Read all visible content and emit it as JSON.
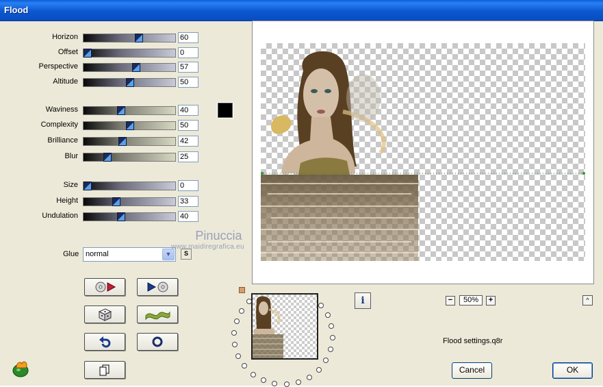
{
  "window": {
    "title": "Flood"
  },
  "sliders": [
    {
      "label": "Horizon",
      "value": "60",
      "style": "gray"
    },
    {
      "label": "Offset",
      "value": "0",
      "style": "gray"
    },
    {
      "label": "Perspective",
      "value": "57",
      "style": "gray"
    },
    {
      "label": "Altitude",
      "value": "50",
      "style": "gray"
    },
    {
      "label": "Waviness",
      "value": "40",
      "style": "olive"
    },
    {
      "label": "Complexity",
      "value": "50",
      "style": "olive"
    },
    {
      "label": "Brilliance",
      "value": "42",
      "style": "olive"
    },
    {
      "label": "Blur",
      "value": "25",
      "style": "olive"
    },
    {
      "label": "Size",
      "value": "0",
      "style": "gray"
    },
    {
      "label": "Height",
      "value": "33",
      "style": "gray"
    },
    {
      "label": "Undulation",
      "value": "40",
      "style": "gray"
    }
  ],
  "glue": {
    "label": "Glue",
    "value": "normal",
    "s_label": "S"
  },
  "watermark": {
    "name": "Pinuccia",
    "url": "www.maidiregrafica.eu"
  },
  "zoom": {
    "value": "50%",
    "minus": "−",
    "plus": "+"
  },
  "info_label": "i",
  "caret_label": "^",
  "settings_file": "Flood settings.q8r",
  "buttons": {
    "cancel": "Cancel",
    "ok": "OK"
  },
  "colors": {
    "waviness_color": "#000000",
    "title_bar": "#0a58d0"
  },
  "icons": {
    "tool_buttons": [
      "load-preset-icon",
      "save-preset-icon",
      "random-dice-icon",
      "wave-icon",
      "undo-icon",
      "reset-icon",
      "copy-icon"
    ]
  }
}
